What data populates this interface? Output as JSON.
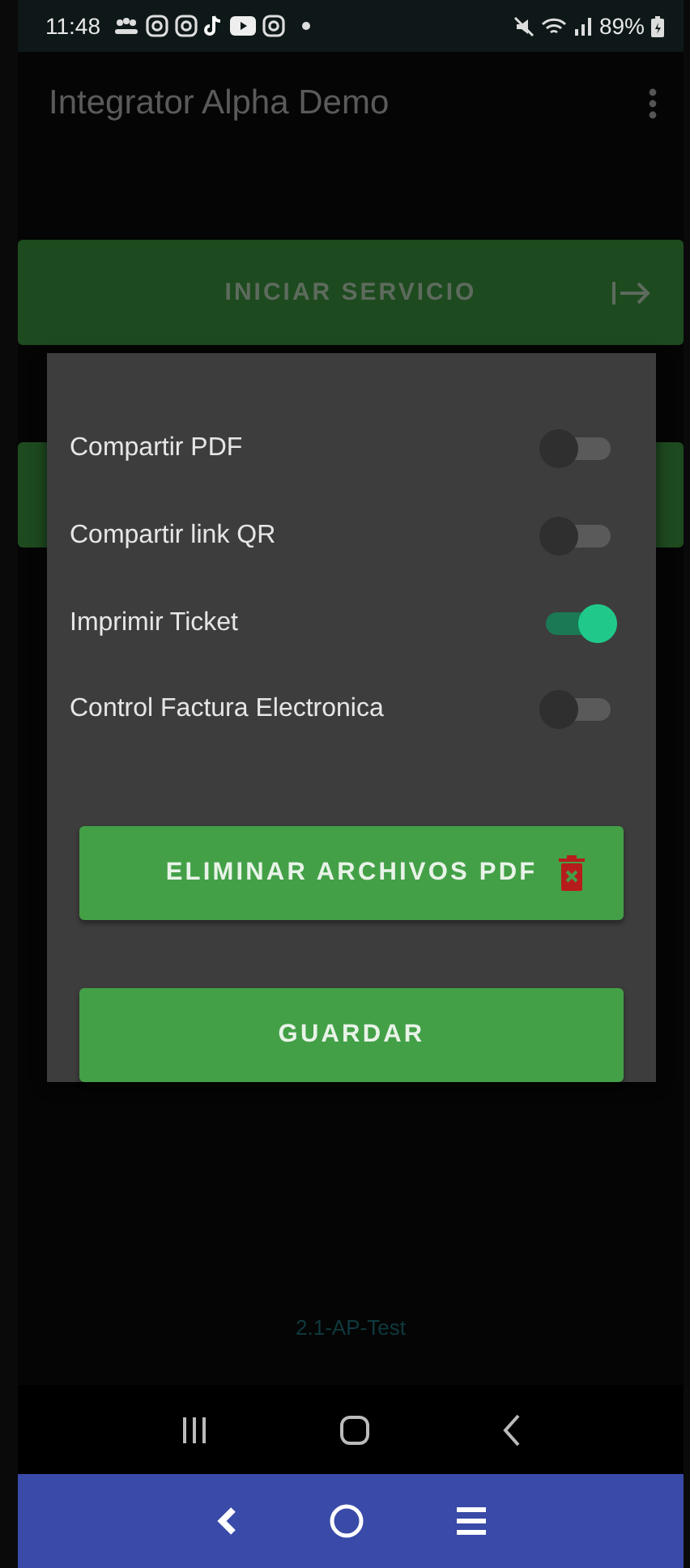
{
  "status_bar": {
    "time": "11:48",
    "battery": "89%"
  },
  "app_bar": {
    "title": "Integrator Alpha Demo"
  },
  "main_buttons": [
    {
      "kind": "labeled",
      "label": "INICIAR SERVICIO"
    },
    {
      "kind": "covered"
    }
  ],
  "dialog": {
    "settings": [
      {
        "label": "Compartir PDF",
        "on": false
      },
      {
        "label": "Compartir link QR",
        "on": false
      },
      {
        "label": "Imprimir Ticket",
        "on": true
      },
      {
        "label": "Control Factura Electronica",
        "on": false
      }
    ],
    "delete_button": "ELIMINAR ARCHIVOS PDF",
    "save_button": "GUARDAR"
  },
  "version": "2.1-AP-Test"
}
